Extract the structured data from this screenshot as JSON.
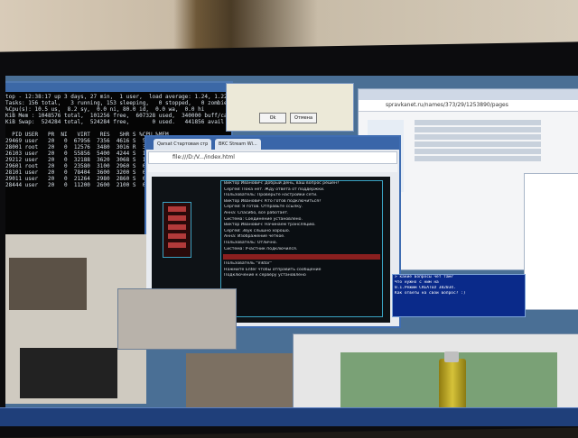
{
  "scene": {
    "description_label": ""
  },
  "terminal": {
    "lines": [
      "top - 12:38:17 up 3 days, 27 min,  1 user,  load average: 1.24, 1.22, 1.10",
      "Tasks: 156 total,   3 running, 153 sleeping,   0 stopped,   0 zombie",
      "%Cpu(s): 10.5 us,  8.2 sy,  0.0 ni, 80.0 id,  0.0 wa,  0.0 hi",
      "KiB Mem : 1048576 total,  101256 free,  607328 used,  340000 buff/cache",
      "KiB Swap:  524284 total,  524284 free,       0 used.   441856 avail Mem",
      "",
      "  PID USER   PR  NI   VIRT   RES   SHR S %CPU %MEM",
      "29469 user   20   0  67956  7356  4616 S  5.6  0.7",
      "28001 root   20   0  12576  3480  3016 R  3.2  0.3",
      "26103 user   20   0  55856  5400  4244 S  1.6  0.5",
      "29212 user   20   0  32188  3620  3068 S  1.0  0.3",
      "29601 root   20   0  23580  3100  2960 S  0.6  0.3",
      "28101 user   20   0  78404  3600  3200 S  0.3  0.3",
      "29011 user   20   0  21264  2980  2860 S  0.3  0.3",
      "28444 user   20   0  11200  2600  2100 S  0.0  0.2"
    ]
  },
  "dialog": {
    "title": "",
    "ok_label": "Ok",
    "cancel_label": "Отмена"
  },
  "right_browser": {
    "url": "spravkanet.ru/names/373/29/1253890/pages"
  },
  "main_window": {
    "tab1": "Qarsat Стартовая стр",
    "tab2": "ВКС Stream Wi...",
    "url": "file:///D:/V.../index.html",
    "chat_lines": [
      "Виктор Иванович: Добрый день, ваш вопрос решен?",
      "Сергей: Пока нет. Жду ответа от поддержки.",
      "Пользователь: Проверьте настройки сети.",
      "Виктор Иванович: Кто готов подключиться?",
      "Сергей: Я готов. Отправьте ссылку.",
      "Анна: Спасибо, все работает.",
      "Система: Соединение установлено.",
      "Виктор Иванович: Начинаем трансляцию.",
      "Сергей: Звук слышно хорошо.",
      "Анна: Изображение четкое.",
      "Пользователь: Отлично.",
      "Система: Участник подключился."
    ],
    "footer_lines": [
      "Пользователь \"Viktor\"",
      "Нажмите Enter чтобы отправить сообщение",
      "Подключение к серверу установлено"
    ]
  },
  "cmd": {
    "lines": [
      "> какие вопросы чет там?",
      "Что нужно с ним на",
      "   0.1.Режим CREATED 382034.",
      "Как ответы на свой вопрос? :)"
    ]
  }
}
